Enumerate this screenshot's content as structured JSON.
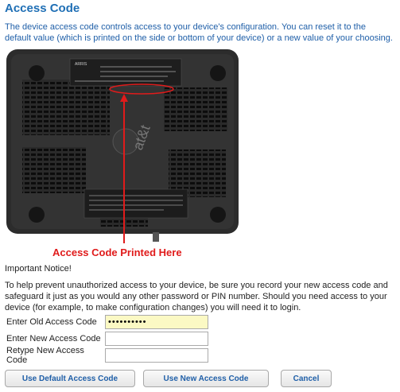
{
  "page": {
    "title": "Access Code",
    "description": "The device access code controls access to your device's configuration. You can reset it to the default value (which is printed on the side or bottom of your device) or a new value of your choosing.",
    "notice": "Important Notice!",
    "warning": "To help prevent unauthorized access to your device, be sure you record your new access code and safeguard it just as you would any other password or PIN number. Should you need access to your device (for example, to make configuration changes) you will need it to login."
  },
  "image": {
    "caption": "Access Code Printed Here",
    "brand": "ARRIS",
    "logo_text": "at&t",
    "accent_color": "#e01b1b"
  },
  "form": {
    "old_label": "Enter Old Access Code",
    "old_value": "••••••••••",
    "new_label": "Enter New Access Code",
    "new_value": "",
    "retype_label": "Retype New Access Code",
    "retype_value": ""
  },
  "buttons": {
    "default": "Use Default Access Code",
    "new": "Use New Access Code",
    "cancel": "Cancel"
  }
}
